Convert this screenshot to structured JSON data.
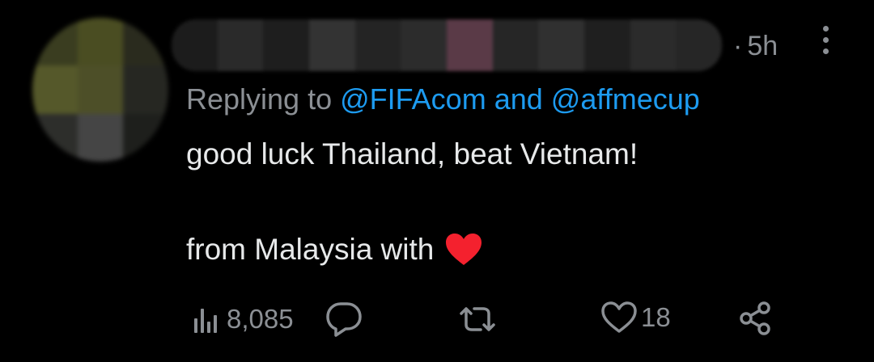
{
  "tweet": {
    "time_separator": "·",
    "time": "5h",
    "reply_prefix": "Replying to",
    "reply_user_1": "@FIFAcom",
    "reply_joiner": "and",
    "reply_user_2": "@affmecup",
    "body_line_1": "good luck Thailand, beat Vietnam!",
    "body_line_2": "from Malaysia with",
    "emoji": "red-heart-icon"
  },
  "actions": {
    "views_count": "8,085",
    "likes_count": "18"
  },
  "colors": {
    "background": "#000000",
    "text": "#e7e9ea",
    "muted": "#8b8f94",
    "link": "#1d9bf0",
    "heart": "#f4212e"
  }
}
